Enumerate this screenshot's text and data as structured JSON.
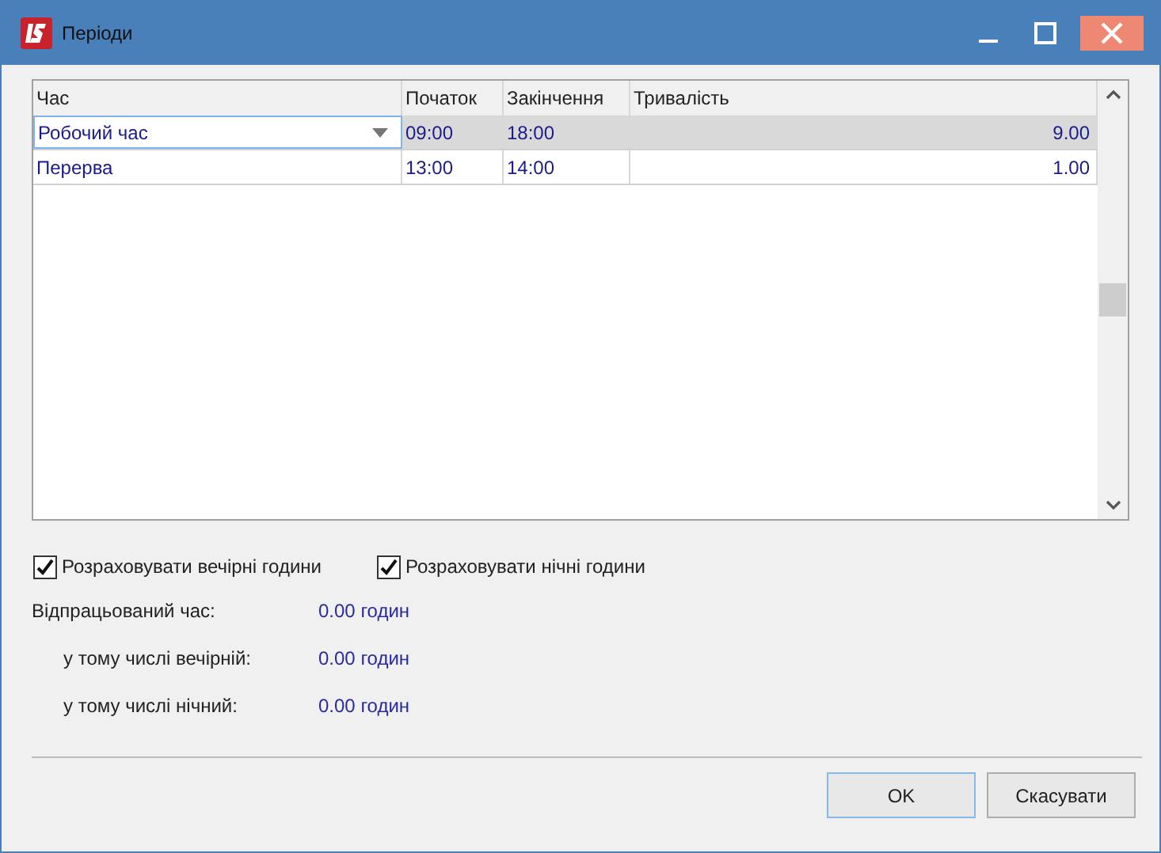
{
  "window": {
    "title": "Періоди"
  },
  "table": {
    "columns": [
      "Час",
      "Початок",
      "Закінчення",
      "Тривалість"
    ],
    "rows": [
      {
        "cells": [
          "Робочий час",
          "09:00",
          "18:00",
          "9.00"
        ],
        "selected": true
      },
      {
        "cells": [
          "Перерва",
          "13:00",
          "14:00",
          "1.00"
        ],
        "selected": false
      }
    ]
  },
  "options": [
    {
      "label": "Розраховувати вечірні години",
      "checked": true
    },
    {
      "label": "Розраховувати нічні години",
      "checked": true
    }
  ],
  "summary": [
    {
      "label": "Відпрацьований час:",
      "value": "0.00 годин",
      "indented": false
    },
    {
      "label": "у тому числі вечірній:",
      "value": "0.00 годин",
      "indented": true
    },
    {
      "label": "у тому числі нічний:",
      "value": "0.00 годин",
      "indented": true
    }
  ],
  "buttons": [
    {
      "label": "OK",
      "default": true
    },
    {
      "label": "Скасувати",
      "default": false
    }
  ]
}
